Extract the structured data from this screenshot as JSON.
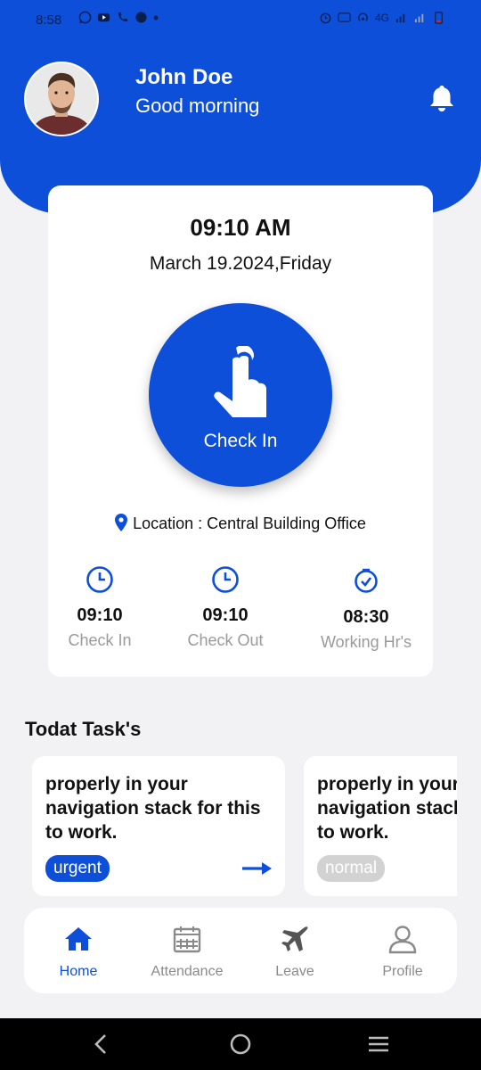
{
  "status_bar": {
    "time": "8:58",
    "network": "4G",
    "notification_icons": [
      "whatsapp-icon",
      "youtube-icon",
      "missed-call-icon",
      "whatsapp-icon"
    ],
    "system_icons": [
      "alarm-icon",
      "volte-icon",
      "hotspot-icon",
      "signal-icon",
      "battery-icon"
    ]
  },
  "header": {
    "user_name": "John Doe",
    "greeting": "Good morning",
    "avatar": "avatar",
    "bell_icon": "bell-icon"
  },
  "attendance": {
    "time": "09:10 AM",
    "date": "March 19.2024,Friday",
    "check_in_label": "Check In",
    "location_text": "Location : Central Building Office",
    "stats": [
      {
        "value": "09:10",
        "label": "Check In",
        "icon": "clock-icon"
      },
      {
        "value": "09:10",
        "label": "Check Out",
        "icon": "clock-icon"
      },
      {
        "value": "08:30",
        "label": "Working Hr's",
        "icon": "check-clock-icon"
      }
    ]
  },
  "tasks": {
    "title": "Todat Task's",
    "items": [
      {
        "text": "properly in your navigation stack for this to work.",
        "priority": "urgent"
      },
      {
        "text": "properly in your navigation stack for this to work.",
        "priority": "normal"
      }
    ]
  },
  "bottom_nav": {
    "items": [
      {
        "label": "Home",
        "icon": "home-icon",
        "active": true
      },
      {
        "label": "Attendance",
        "icon": "calendar-icon",
        "active": false
      },
      {
        "label": "Leave",
        "icon": "airplane-icon",
        "active": false
      },
      {
        "label": "Profile",
        "icon": "user-icon",
        "active": false
      }
    ]
  },
  "colors": {
    "primary": "#0d4fd9",
    "background": "#f2f2f4",
    "badge_normal": "#d2d2d2",
    "muted_text": "#9a9a9a"
  }
}
